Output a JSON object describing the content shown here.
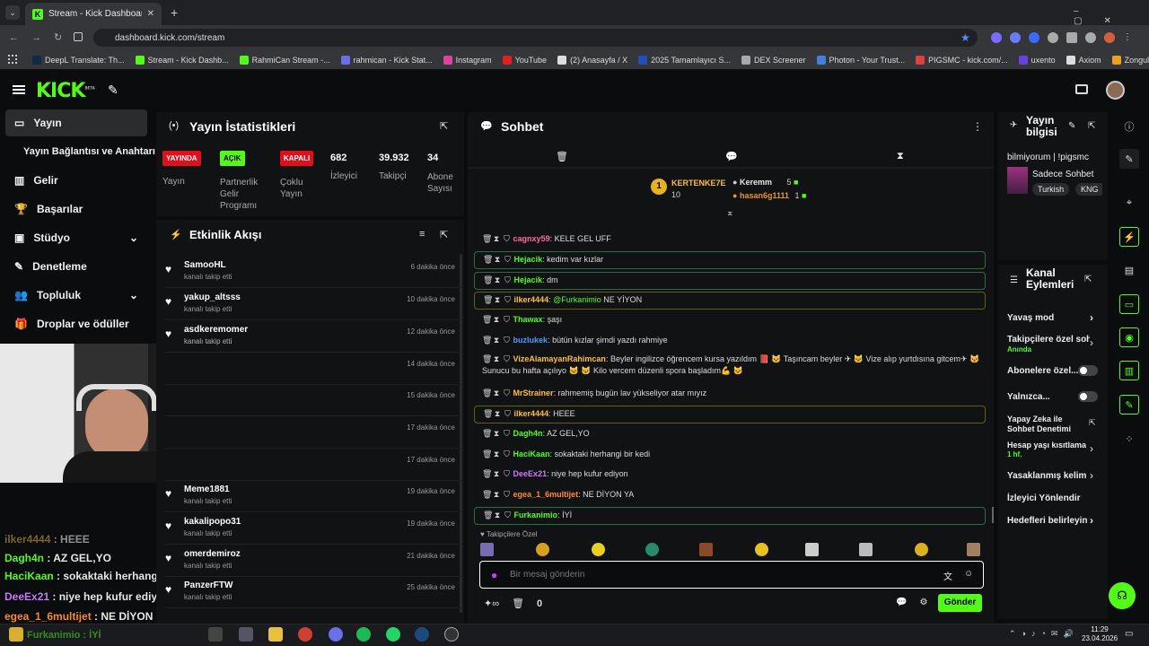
{
  "browser": {
    "tab_title": "Stream - Kick Dashboard",
    "url": "dashboard.kick.com/stream",
    "bookmarks": [
      "DeepL Translate: Th...",
      "Stream - Kick Dashb...",
      "RahmiCan Stream -...",
      "rahmican - Kick Stat...",
      "Instagram",
      "YouTube",
      "(2) Anasayfa / X",
      "2025 Tamamlayıcı S...",
      "DEX Screener",
      "Photon - Your Trust...",
      "PIGSMC - kick.com/...",
      "uxento",
      "Axiom",
      "Zonguldak İngilizce..."
    ]
  },
  "app": {
    "logo": "KICK",
    "beta": "BETA"
  },
  "sidebar": {
    "items": [
      "Yayın",
      "Yayın Bağlantısı ve Anahtarı",
      "Gelir",
      "Başarılar",
      "Stüdyo",
      "Denetleme",
      "Topluluk",
      "Droplar ve ödüller"
    ]
  },
  "stats": {
    "title": "Yayın İstatistikleri",
    "items": [
      {
        "value": "YAYINDA",
        "label": "Yayın",
        "color": "#e10f1b"
      },
      {
        "value": "AÇIK",
        "label": "Partnerlik Gelir Programı",
        "color": "#53fc18"
      },
      {
        "value": "KAPALI",
        "label": "Çoklu Yayın",
        "color": "#e10f1b"
      },
      {
        "value": "682",
        "label": "İzleyici"
      },
      {
        "value": "39.932",
        "label": "Takipçi"
      },
      {
        "value": "34",
        "label": "Abone Sayısı"
      }
    ]
  },
  "activity": {
    "title": "Etkinlik Akışı",
    "sub": "kanalı takip etti",
    "items": [
      {
        "name": "SamooHL",
        "time": "6 dakika önce"
      },
      {
        "name": "yakup_altsss",
        "time": "10 dakika önce"
      },
      {
        "name": "asdkeremomer",
        "time": "12 dakika önce"
      },
      {
        "name": "",
        "time": "14 dakika önce"
      },
      {
        "name": "",
        "time": "15 dakika önce"
      },
      {
        "name": "",
        "time": "17 dakika önce"
      },
      {
        "name": "",
        "time": "17 dakika önce"
      },
      {
        "name": "Meme1881",
        "time": "19 dakika önce"
      },
      {
        "name": "kakalipopo31",
        "time": "19 dakika önce"
      },
      {
        "name": "omerdemiroz",
        "time": "21 dakika önce"
      },
      {
        "name": "PanzerFTW",
        "time": "25 dakika önce"
      }
    ]
  },
  "chat": {
    "title": "Sohbet",
    "top": {
      "first_name": "KERTENKE7E",
      "first_count": "10",
      "second_name": "Keremm",
      "second_count": "5",
      "third_name": "hasan6g1111",
      "third_count": "1"
    },
    "messages": [
      {
        "user": "cagnxy59",
        "color": "#ff6b9a",
        "text": ": KELE GEL UFF"
      },
      {
        "user": "Hejacik",
        "color": "#53fc18",
        "text": ": kedim var kızlar"
      },
      {
        "user": "Hejacik",
        "color": "#53fc18",
        "text": ": dm"
      },
      {
        "user": "ilker4444",
        "color": "#ffbe3b",
        "text": ": ",
        "mention": "@Furkanimio",
        "tail": " NE YİYON"
      },
      {
        "user": "Thawax",
        "color": "#53fc18",
        "text": ": şaşı"
      },
      {
        "user": "buzlukek",
        "color": "#4a9dff",
        "text": ": bütün kızlar şimdi yazdı rahmiye"
      },
      {
        "user": "VizeAlamayanRahimcan",
        "color": "#ffbe3b",
        "text": ": Beyler ingilizce öğrencem kursa yazıldım 📕 🐱 Taşıncam beyler ✈ 🐱 Vize alıp yurtdısına gitcem✈ 🐱 Sunucu bu hafta açılıyo 🐱 🐱 Kilo vercem düzenli spora başladım💪 🐱"
      },
      {
        "user": "MrStrainer",
        "color": "#ffbe3b",
        "text": ": rahmemiş bugün lav yükseliyor atar mıyız"
      },
      {
        "user": "ilker4444",
        "color": "#ffbe3b",
        "text": ": HEEE"
      },
      {
        "user": "Dagh4n",
        "color": "#53fc18",
        "text": ": AZ GEL,YO"
      },
      {
        "user": "HaciKaan",
        "color": "#53fc18",
        "text": ": sokaktaki herhangi bir kedi"
      },
      {
        "user": "DeeEx21",
        "color": "#c879ff",
        "text": ": niye hep kufur ediyon"
      },
      {
        "user": "egea_1_6multijet",
        "color": "#ff8c1a",
        "text": ": NE DİYON YA"
      },
      {
        "user": "Furkanimio",
        "color": "#53fc18",
        "text": ": İYİ"
      }
    ],
    "emote_label": "Takipçilere Özel",
    "placeholder": "Bir mesaj gönderin",
    "send": "Gönder",
    "count": "0"
  },
  "info": {
    "title": "Yayın bilgisi",
    "stream_title": "bilmiyorum | !pigsmc",
    "category": "Sadece Sohbet",
    "tags": [
      "Turkish",
      "KNG"
    ]
  },
  "actions": {
    "title": "Kanal Eylemleri",
    "items": [
      "Yavaş mod",
      "Takipçilere özel sohbet",
      "Abonelere özel...",
      "Yalnızca...",
      "Yapay Zeka ile Sohbet Denetimi",
      "Hesap yaşı kısıtlaması",
      "Yasaklanmış kelimeler",
      "İzleyici Yönlendir",
      "Hedefleri belirleyin"
    ],
    "sub_anında": "Anında",
    "sub_1hf": "1 hf."
  },
  "overlay": [
    {
      "user": "ilker4444",
      "text": " : HEEE",
      "color": "#c6a23a"
    },
    {
      "user": "Dagh4n",
      "text": " : AZ GEL,YO",
      "color": "#53fc18"
    },
    {
      "user": "HaciKaan",
      "text": " : sokaktaki herhangi bir kedi",
      "color": "#53fc18"
    },
    {
      "user": "DeeEx21",
      "text": " : niye hep kufur ediyon",
      "color": "#c879ff"
    },
    {
      "user": "egea_1_6multijet",
      "text": " : NE DİYON YA",
      "color": "#ff8c1a"
    },
    {
      "user": "Furkanimio",
      "text": " : İYİ",
      "color": "#53fc18"
    }
  ],
  "taskbar": {
    "time": "11:29",
    "date": "23.04.2026"
  }
}
